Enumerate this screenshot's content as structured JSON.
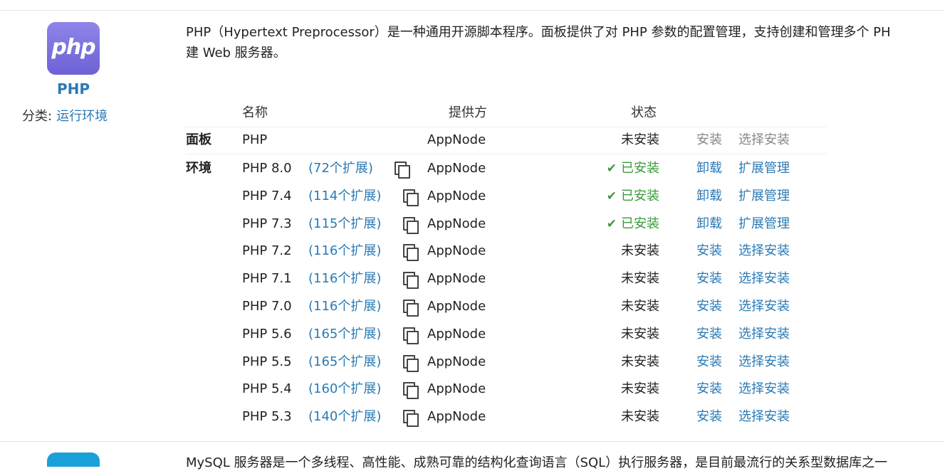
{
  "app": {
    "icon_text": "php",
    "name": "PHP",
    "category_label": "分类:",
    "category_link": "运行环境",
    "description_line1": "PHP（Hypertext Preprocessor）是一种通用开源脚本程序。面板提供了对 PHP 参数的配置管理，支持创建和管理多个 PH",
    "description_line2": "建 Web 服务器。"
  },
  "table": {
    "headers": {
      "name": "名称",
      "provider": "提供方",
      "status": "状态"
    },
    "panel_row": {
      "group": "面板",
      "name": "PHP",
      "provider": "AppNode",
      "status": "未安装",
      "action1": "安装",
      "action2": "选择安装"
    },
    "env_group": "环境",
    "rows": [
      {
        "name": "PHP 8.0",
        "ext": "(72个扩展)",
        "provider": "AppNode",
        "status": "已安装",
        "installed": true,
        "action1": "卸载",
        "action2": "扩展管理"
      },
      {
        "name": "PHP 7.4",
        "ext": "(114个扩展)",
        "provider": "AppNode",
        "status": "已安装",
        "installed": true,
        "action1": "卸载",
        "action2": "扩展管理"
      },
      {
        "name": "PHP 7.3",
        "ext": "(115个扩展)",
        "provider": "AppNode",
        "status": "已安装",
        "installed": true,
        "action1": "卸载",
        "action2": "扩展管理"
      },
      {
        "name": "PHP 7.2",
        "ext": "(116个扩展)",
        "provider": "AppNode",
        "status": "未安装",
        "installed": false,
        "action1": "安装",
        "action2": "选择安装"
      },
      {
        "name": "PHP 7.1",
        "ext": "(116个扩展)",
        "provider": "AppNode",
        "status": "未安装",
        "installed": false,
        "action1": "安装",
        "action2": "选择安装"
      },
      {
        "name": "PHP 7.0",
        "ext": "(116个扩展)",
        "provider": "AppNode",
        "status": "未安装",
        "installed": false,
        "action1": "安装",
        "action2": "选择安装"
      },
      {
        "name": "PHP 5.6",
        "ext": "(165个扩展)",
        "provider": "AppNode",
        "status": "未安装",
        "installed": false,
        "action1": "安装",
        "action2": "选择安装"
      },
      {
        "name": "PHP 5.5",
        "ext": "(165个扩展)",
        "provider": "AppNode",
        "status": "未安装",
        "installed": false,
        "action1": "安装",
        "action2": "选择安装"
      },
      {
        "name": "PHP 5.4",
        "ext": "(160个扩展)",
        "provider": "AppNode",
        "status": "未安装",
        "installed": false,
        "action1": "安装",
        "action2": "选择安装"
      },
      {
        "name": "PHP 5.3",
        "ext": "(140个扩展)",
        "provider": "AppNode",
        "status": "未安装",
        "installed": false,
        "action1": "安装",
        "action2": "选择安装"
      }
    ]
  },
  "next_app": {
    "description": "MySQL 服务器是一个多线程、高性能、成熟可靠的结构化查询语言（SQL）执行服务器，是目前最流行的关系型数据库之一"
  },
  "colors": {
    "link": "#2a7ab5",
    "installed": "#3a9a3a",
    "icon_gradient_top": "#8f85e9",
    "icon_gradient_bottom": "#6e61d6"
  }
}
